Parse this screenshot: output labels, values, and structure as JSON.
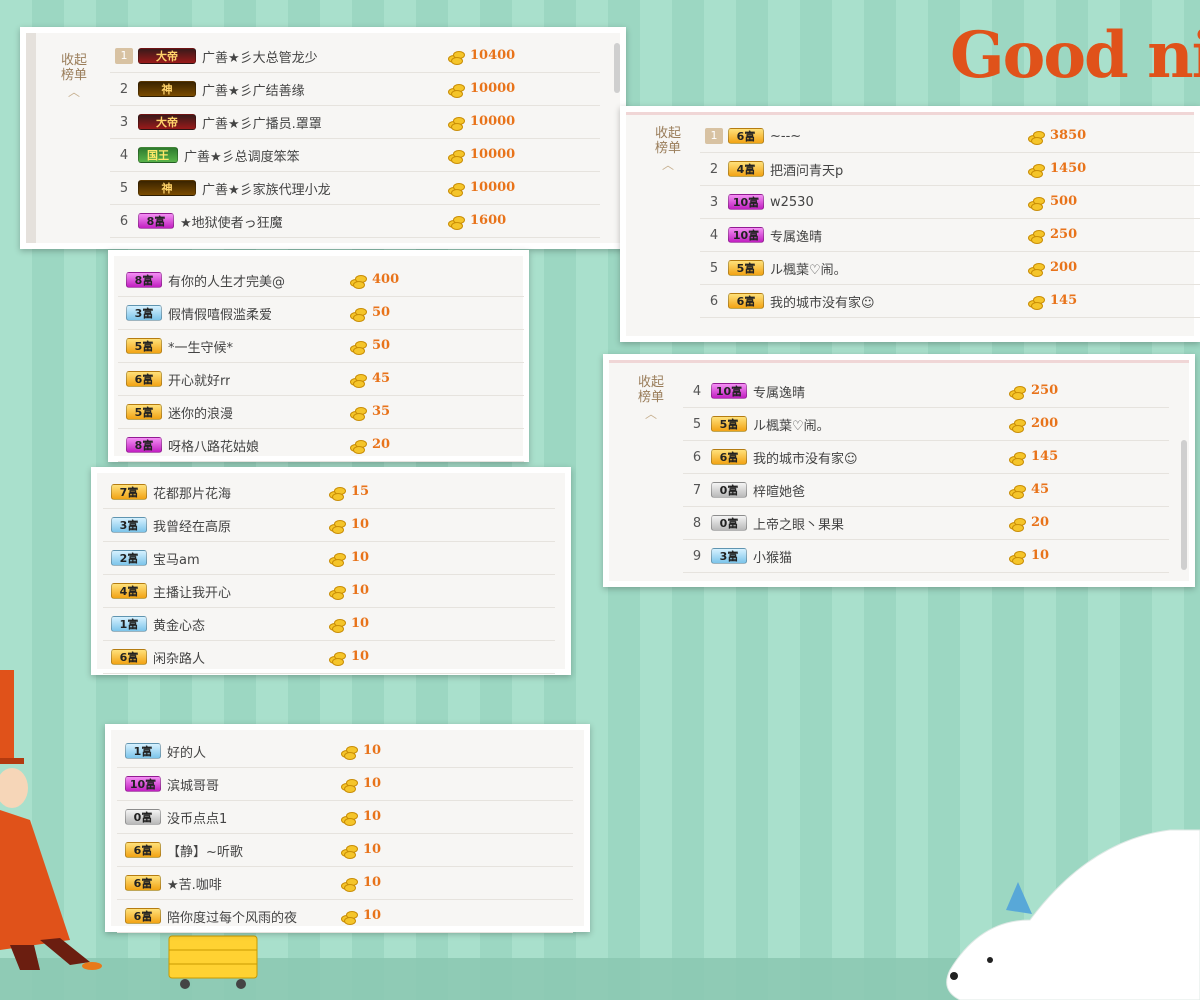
{
  "decor": {
    "title_text": "Good nigh"
  },
  "collapse_label_line1": "收起",
  "collapse_label_line2": "榜单",
  "panel1": {
    "rows": [
      {
        "rank": "1",
        "badge": "大帝",
        "badge_style": "dark",
        "name": "广善★彡大总管龙少",
        "amount": "10400"
      },
      {
        "rank": "2",
        "badge": "神",
        "badge_style": "gold",
        "name": "广善★彡广结善缘",
        "amount": "10000"
      },
      {
        "rank": "3",
        "badge": "大帝",
        "badge_style": "dark",
        "name": "广善★彡广播员.罩罩",
        "amount": "10000"
      },
      {
        "rank": "4",
        "badge": "国王",
        "badge_style": "green",
        "name": "广善★彡总调度笨笨",
        "amount": "10000"
      },
      {
        "rank": "5",
        "badge": "神",
        "badge_style": "gold",
        "name": "广善★彡家族代理小龙",
        "amount": "10000"
      },
      {
        "rank": "6",
        "badge": "8富",
        "badge_style": "magenta",
        "name": "★地狱使者っ狂魔",
        "amount": "1600"
      }
    ]
  },
  "panel2": {
    "rows": [
      {
        "badge": "8富",
        "badge_style": "magenta",
        "name": "有你的人生才完美@",
        "amount": "400"
      },
      {
        "badge": "3富",
        "badge_style": "blue",
        "name": "假情假嘻假滥柔爱",
        "amount": "50"
      },
      {
        "badge": "5富",
        "badge_style": "orange",
        "name": "*一生守候*",
        "amount": "50"
      },
      {
        "badge": "6富",
        "badge_style": "orange",
        "name": "开心就好rr",
        "amount": "45"
      },
      {
        "badge": "5富",
        "badge_style": "orange",
        "name": "迷你的浪漫",
        "amount": "35"
      },
      {
        "badge": "8富",
        "badge_style": "magenta",
        "name": "呀格八路花姑娘",
        "amount": "20"
      }
    ]
  },
  "panel3": {
    "rows": [
      {
        "badge": "7富",
        "badge_style": "orange",
        "name": "花都那片花海",
        "amount": "15"
      },
      {
        "badge": "3富",
        "badge_style": "blue",
        "name": "我曾经在高原",
        "amount": "10"
      },
      {
        "badge": "2富",
        "badge_style": "blue",
        "name": "宝马am",
        "amount": "10"
      },
      {
        "badge": "4富",
        "badge_style": "orange",
        "name": "主播让我开心",
        "amount": "10"
      },
      {
        "badge": "1富",
        "badge_style": "blue",
        "name": "黄金心态",
        "amount": "10"
      },
      {
        "badge": "6富",
        "badge_style": "orange",
        "name": "闲杂路人",
        "amount": "10"
      }
    ]
  },
  "panel4": {
    "rows": [
      {
        "badge": "1富",
        "badge_style": "blue",
        "name": "好的人",
        "amount": "10"
      },
      {
        "badge": "10富",
        "badge_style": "magenta",
        "name": "滨城哥哥",
        "amount": "10"
      },
      {
        "badge": "0富",
        "badge_style": "gray",
        "name": "没币点点1",
        "amount": "10"
      },
      {
        "badge": "6富",
        "badge_style": "orange",
        "name": "【静】~听歌",
        "amount": "10"
      },
      {
        "badge": "6富",
        "badge_style": "orange",
        "name": "★苦.咖啡",
        "amount": "10"
      },
      {
        "badge": "6富",
        "badge_style": "orange",
        "name": "陪你度过每个风雨的夜",
        "amount": "10"
      }
    ]
  },
  "panel5": {
    "rows": [
      {
        "rank": "1",
        "badge": "6富",
        "badge_style": "orange",
        "name": "~--~",
        "amount": "3850"
      },
      {
        "rank": "2",
        "badge": "4富",
        "badge_style": "orange",
        "name": "把酒问青天p",
        "amount": "1450"
      },
      {
        "rank": "3",
        "badge": "10富",
        "badge_style": "magenta",
        "name": "w2530",
        "amount": "500"
      },
      {
        "rank": "4",
        "badge": "10富",
        "badge_style": "magenta",
        "name": "专属逸晴",
        "amount": "250"
      },
      {
        "rank": "5",
        "badge": "5富",
        "badge_style": "orange",
        "name": "ル楓葉♡闹。",
        "amount": "200"
      },
      {
        "rank": "6",
        "badge": "6富",
        "badge_style": "orange",
        "name": "我的城市没有家☺",
        "amount": "145"
      }
    ]
  },
  "panel6": {
    "rows": [
      {
        "rank": "4",
        "badge": "10富",
        "badge_style": "magenta",
        "name": "专属逸晴",
        "amount": "250"
      },
      {
        "rank": "5",
        "badge": "5富",
        "badge_style": "orange",
        "name": "ル楓葉♡闹。",
        "amount": "200"
      },
      {
        "rank": "6",
        "badge": "6富",
        "badge_style": "orange",
        "name": "我的城市没有家☺",
        "amount": "145"
      },
      {
        "rank": "7",
        "badge": "0富",
        "badge_style": "gray",
        "name": "梓暄她爸",
        "amount": "45"
      },
      {
        "rank": "8",
        "badge": "0富",
        "badge_style": "gray",
        "name": "上帝之眼丶果果",
        "amount": "20"
      },
      {
        "rank": "9",
        "badge": "3富",
        "badge_style": "blue",
        "name": "小猴猫",
        "amount": "10"
      }
    ]
  }
}
